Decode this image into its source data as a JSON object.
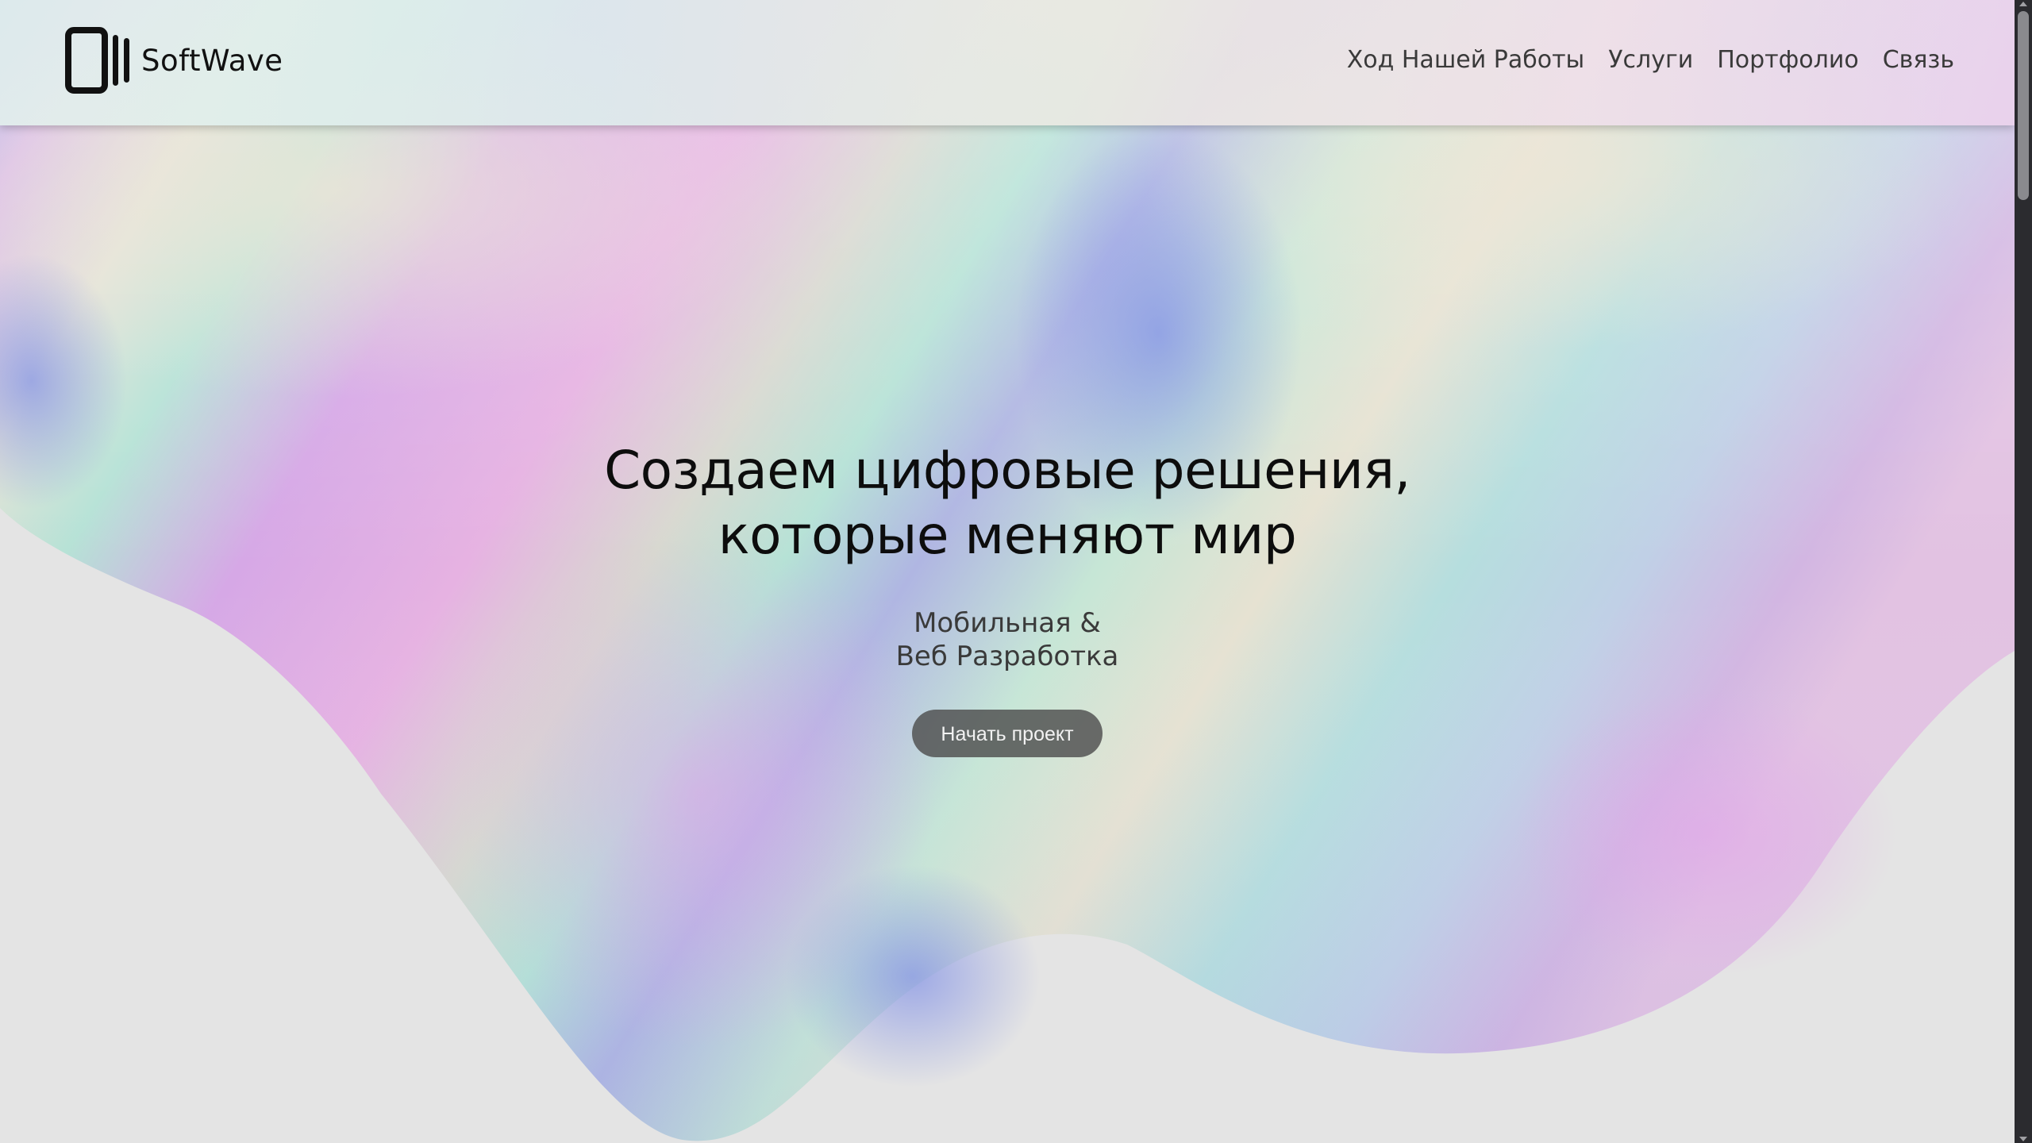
{
  "brand": {
    "name": "SoftWave"
  },
  "nav": {
    "items": [
      {
        "label": "Ход Нашей Работы"
      },
      {
        "label": "Услуги"
      },
      {
        "label": "Портфолио"
      },
      {
        "label": "Связь"
      }
    ]
  },
  "hero": {
    "title_line1": "Создаем цифровые решения,",
    "title_line2": "которые меняют мир",
    "subtitle_line1": "Мобильная &",
    "subtitle_line2": "Веб Разработка",
    "cta_label": "Начать проект"
  },
  "colors": {
    "background": "#e4e4e4",
    "cta": "#4e4e4e",
    "scrollbar": "#2b2b2f"
  }
}
